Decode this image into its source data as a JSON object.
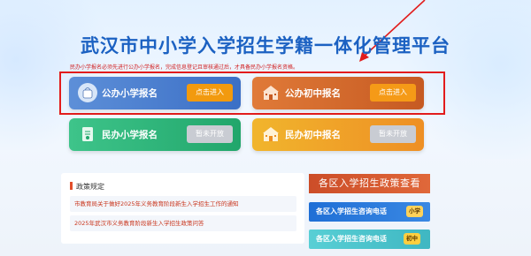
{
  "title": "武汉市中小学入学招生学籍一体化管理平台",
  "notice": "民办小学报名必须先进行公办小学报名，完成信息登记且审核通过后，才具备民办小学报名资格。",
  "cards": [
    {
      "label": "公办小学报名",
      "button": "点击进入",
      "icon": "school-bag-icon"
    },
    {
      "label": "公办初中报名",
      "button": "点击进入",
      "icon": "school-building-icon"
    },
    {
      "label": "民办小学报名",
      "button": "暂未开放",
      "icon": "doc-icon"
    },
    {
      "label": "民办初中报名",
      "button": "暂未开放",
      "icon": "school-building-icon"
    }
  ],
  "policy": {
    "heading": "政策规定",
    "items": [
      "市教育局关于做好2025年义务教育阶段新生入学招生工作的通知",
      "2025年武汉市义务教育阶段新生入学招生政策问答"
    ]
  },
  "district_policy_title": "各区入学招生政策查看",
  "phones": [
    {
      "label": "各区入学招生咨询电话",
      "tag": "小学"
    },
    {
      "label": "各区入学招生咨询电话",
      "tag": "初中"
    }
  ],
  "colors": {
    "highlight": "#e21c1c",
    "title": "#1b61c2",
    "notice": "#d12020"
  }
}
